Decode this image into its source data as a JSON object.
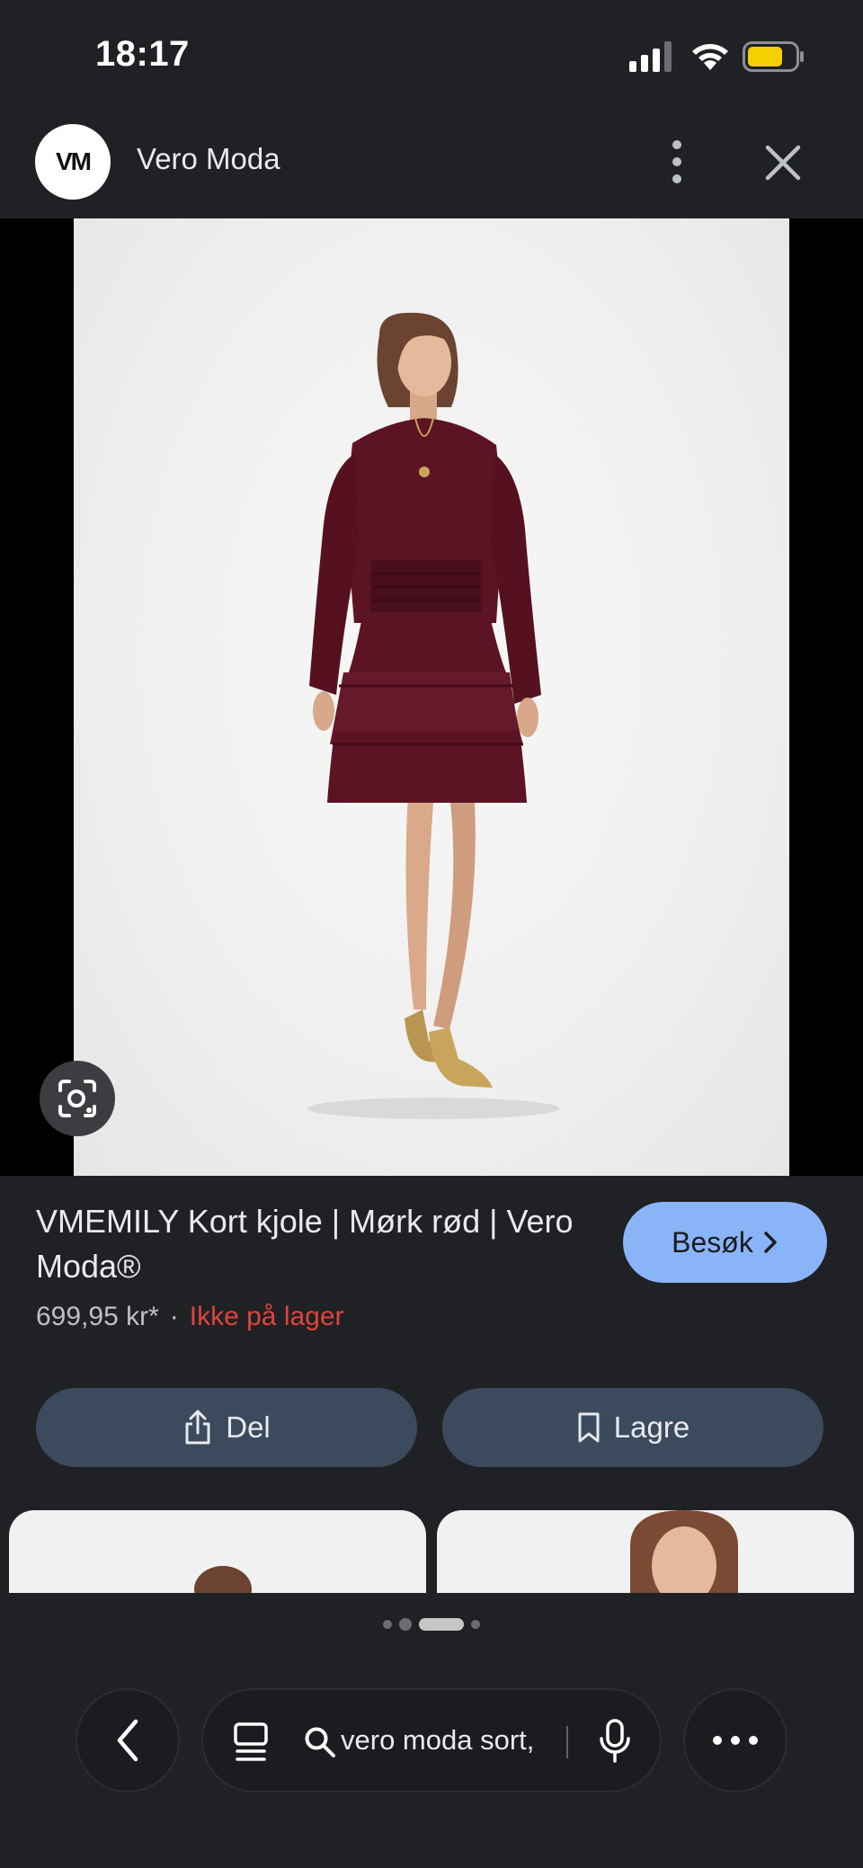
{
  "status_bar": {
    "time": "18:17"
  },
  "header": {
    "logo_text": "VM",
    "brand_name": "Vero Moda"
  },
  "product": {
    "title": "VMEMILY Kort kjole | Mørk rød | Vero Moda®",
    "price": "699,95 kr*",
    "separator": "·",
    "stock_status": "Ikke på lager",
    "visit_label": "Besøk"
  },
  "actions": {
    "share_label": "Del",
    "save_label": "Lagre"
  },
  "search": {
    "query": "vero moda sort,"
  },
  "colors": {
    "accent": "#8ab4f8",
    "stock_red": "#e0443e",
    "dress": "#5c1424",
    "background": "#202124"
  },
  "pager": {
    "pages": 4,
    "active_index": 2
  }
}
